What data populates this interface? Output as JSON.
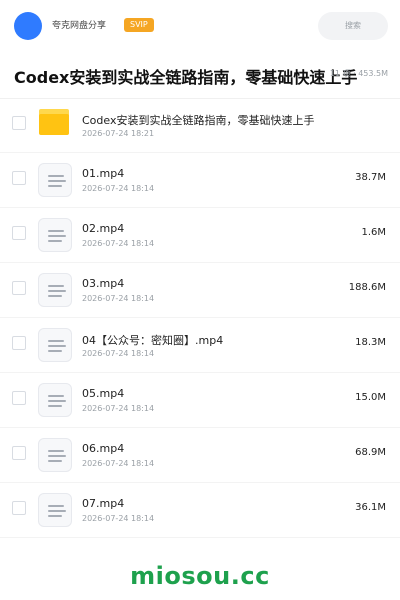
{
  "header": {
    "brand": "夸克网盘分享",
    "badge": "SVIP",
    "search_label": "搜索"
  },
  "title": "Codex安装到实战全链路指南，零基础快速上手",
  "summary": "11 项 · 453.5M",
  "files": [
    {
      "name": "Codex安装到实战全链路指南，零基础快速上手",
      "date": "2026-07-24 18:21",
      "size": "",
      "icon": "folder-icon"
    },
    {
      "name": "01.mp4",
      "date": "2026-07-24 18:14",
      "size": "38.7M",
      "icon": "file-icon"
    },
    {
      "name": "02.mp4",
      "date": "2026-07-24 18:14",
      "size": "1.6M",
      "icon": "file-icon"
    },
    {
      "name": "03.mp4",
      "date": "2026-07-24 18:14",
      "size": "188.6M",
      "icon": "file-icon"
    },
    {
      "name": "04【公众号：密知圈】.mp4",
      "date": "2026-07-24 18:14",
      "size": "18.3M",
      "icon": "file-icon"
    },
    {
      "name": "05.mp4",
      "date": "2026-07-24 18:14",
      "size": "15.0M",
      "icon": "file-icon"
    },
    {
      "name": "06.mp4",
      "date": "2026-07-24 18:14",
      "size": "68.9M",
      "icon": "file-icon"
    },
    {
      "name": "07.mp4",
      "date": "2026-07-24 18:14",
      "size": "36.1M",
      "icon": "file-icon"
    }
  ],
  "watermark": "miosou.cc",
  "colors": {
    "brand_blue": "#2f7bff",
    "svip_orange": "#f5a623",
    "folder_yellow": "#ffc312",
    "watermark_green": "#1ea14d"
  }
}
